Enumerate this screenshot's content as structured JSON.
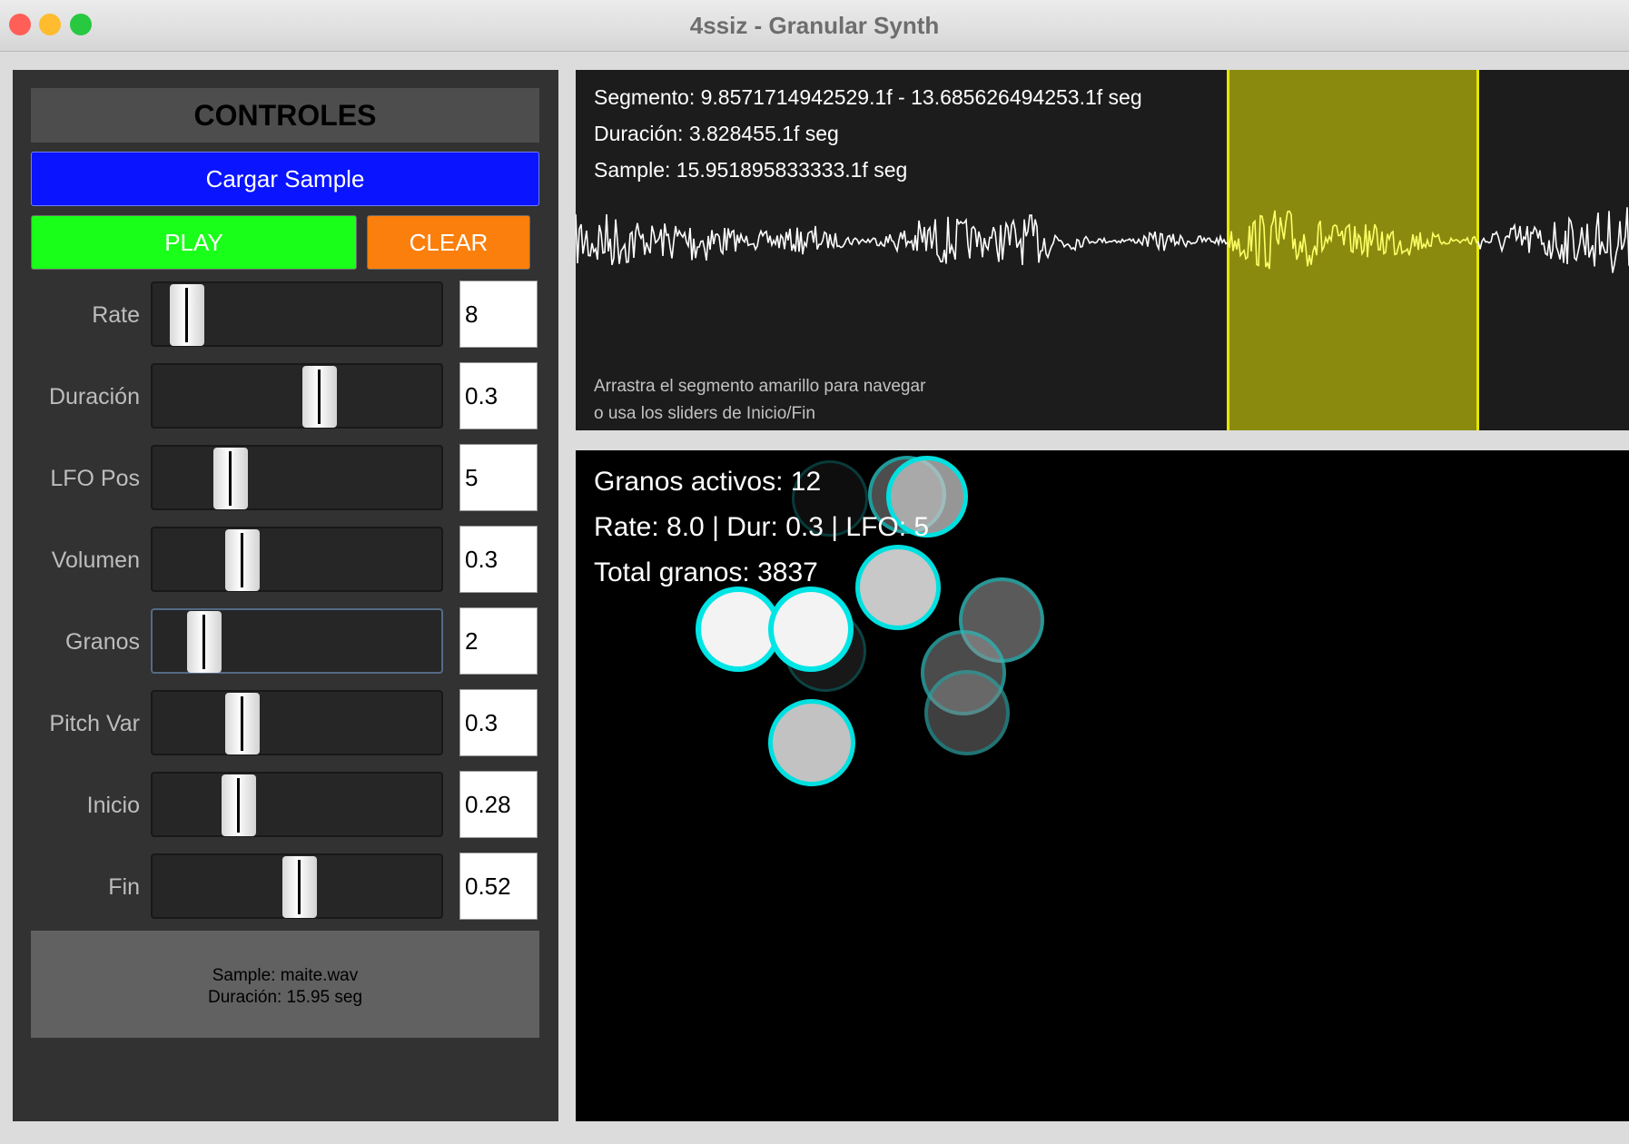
{
  "window": {
    "title": "4ssiz - Granular Synth",
    "traffic_lights": {
      "close": "#ff5f57",
      "minimize": "#febc2e",
      "zoom": "#28c840"
    }
  },
  "controls": {
    "header": "CONTROLES",
    "load_label": "Cargar Sample",
    "play_label": "PLAY",
    "clear_label": "CLEAR",
    "sliders": [
      {
        "label": "Rate",
        "value": "8",
        "position": 0.12
      },
      {
        "label": "Duración",
        "value": "0.3",
        "position": 0.58
      },
      {
        "label": "LFO Pos",
        "value": "5",
        "position": 0.27
      },
      {
        "label": "Volumen",
        "value": "0.3",
        "position": 0.31
      },
      {
        "label": "Granos",
        "value": "2",
        "position": 0.18
      },
      {
        "label": "Pitch Var",
        "value": "0.3",
        "position": 0.31
      },
      {
        "label": "Inicio",
        "value": "0.28",
        "position": 0.3
      },
      {
        "label": "Fin",
        "value": "0.52",
        "position": 0.51
      }
    ],
    "info_sample": "Sample: maite.wav",
    "info_duration": "Duración: 15.95 seg"
  },
  "waveform": {
    "segment_text": "Segmento: 9.8571714942529.1f - 13.685626494253.1f seg",
    "duration_text": "Duración: 3.828455.1f seg",
    "sample_text": "Sample: 15.951895833333.1f seg",
    "hint_line1": "Arrastra el segmento amarillo para navegar",
    "hint_line2": "o usa los sliders de Inicio/Fin",
    "segment_start": 0.618,
    "segment_end": 0.858,
    "wave_color": "#ffffff",
    "segment_wave_color": "#ffff66",
    "segment_color": "#8a8b0e",
    "segment_border_color": "#e6e600"
  },
  "grains": {
    "active_text": "Granos activos: 12",
    "params_text": "Rate: 8.0 | Dur: 0.3 | LFO: 5",
    "total_text": "Total granos: 3837",
    "accent": "#00e5e5"
  }
}
